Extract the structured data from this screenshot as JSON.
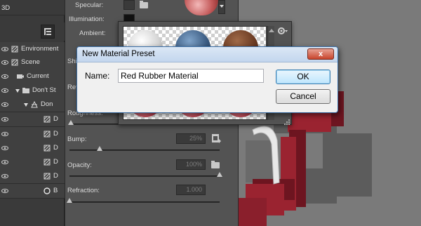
{
  "layers": {
    "tab": "3D",
    "rows": [
      {
        "label": "Environment",
        "icon": "environment-icon",
        "indent": 0
      },
      {
        "label": "Scene",
        "icon": "scene-icon",
        "indent": 0
      },
      {
        "label": "Current",
        "icon": "camera-icon",
        "indent": 1
      },
      {
        "label": "Don't St",
        "icon": "mesh-folder-icon",
        "indent": 1,
        "expanded": true
      },
      {
        "label": "Don",
        "icon": "mesh-icon",
        "indent": 2,
        "expanded": true
      },
      {
        "label": "D",
        "icon": "material-icon",
        "indent": 3
      },
      {
        "label": "D",
        "icon": "material-icon",
        "indent": 3
      },
      {
        "label": "D",
        "icon": "material-icon",
        "indent": 3
      },
      {
        "label": "D",
        "icon": "material-icon",
        "indent": 3
      },
      {
        "label": "D",
        "icon": "material-icon",
        "indent": 3
      },
      {
        "label": "B",
        "icon": "light-icon",
        "indent": 3
      }
    ]
  },
  "properties": {
    "specular_label": "Specular:",
    "illumination_label": "Illumination:",
    "ambient_label": "Ambient:",
    "shine_label": "Shi",
    "reflection_label": "Ref",
    "roughness_label": "Roughness:",
    "bump_label": "Bump:",
    "bump_value": "25%",
    "opacity_label": "Opacity:",
    "opacity_value": "100%",
    "refraction_label": "Refraction:",
    "refraction_value": "1.000",
    "bump_level": 0.2,
    "opacity_level": 1.0,
    "refraction_level": 0.0
  },
  "material_picker": {
    "materials": [
      "white-glossy",
      "blue-glossy",
      "brown-wood"
    ],
    "colors": {
      "white": "#e8e8e8",
      "blue": "#3a5a80",
      "brown": "#6a3a22",
      "red": "#b22a3a"
    }
  },
  "dialog": {
    "title": "New Material Preset",
    "name_label": "Name:",
    "name_value": "Red Rubber Material",
    "ok_label": "OK",
    "cancel_label": "Cancel",
    "close_glyph": "x"
  }
}
